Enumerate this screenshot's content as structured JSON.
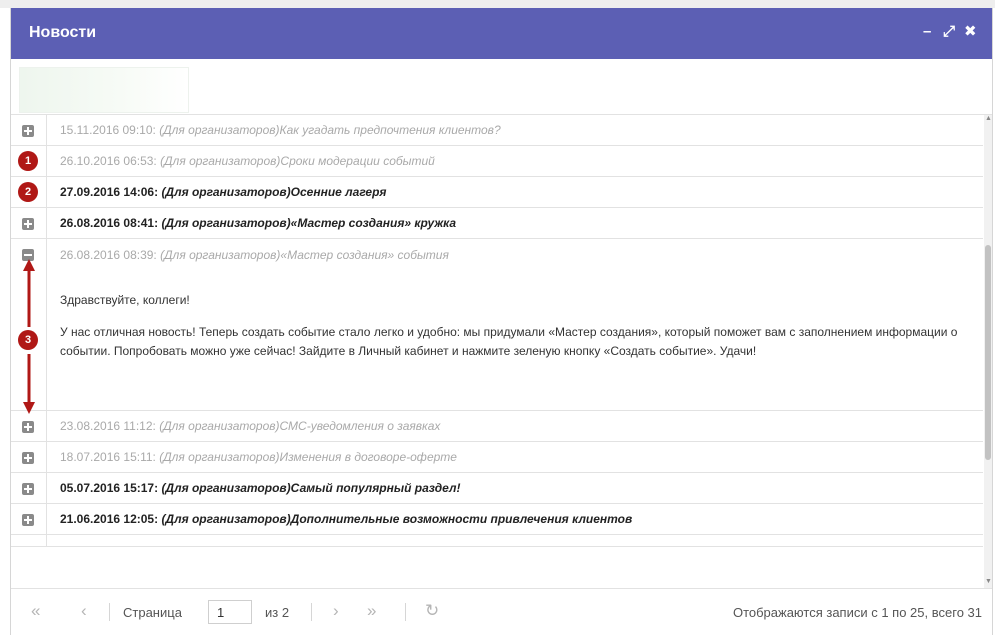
{
  "window": {
    "title": "Новости",
    "minimize_label": "–",
    "maximize_label": "⤢",
    "close_label": "✖"
  },
  "annotations": [
    "1",
    "2",
    "3"
  ],
  "rows_top": [
    {
      "date": "15.11.2016 09:10:",
      "subject": "(Для организаторов)Как угадать предпочтения клиентов?",
      "read": true,
      "marker": "toggle-plus"
    },
    {
      "date": "26.10.2016 06:53:",
      "subject": "(Для организаторов)Сроки модерации событий",
      "read": true,
      "marker": "badge-1"
    },
    {
      "date": "27.09.2016 14:06:",
      "subject": "(Для организаторов)Осенние лагеря",
      "read": false,
      "marker": "badge-2"
    },
    {
      "date": "26.08.2016 08:41:",
      "subject": "(Для организаторов)«Мастер создания» кружка",
      "read": false,
      "marker": "toggle-plus"
    }
  ],
  "expanded": {
    "date": "26.08.2016 08:39:",
    "subject": "(Для организаторов)«Мастер создания» события",
    "greeting": "Здравствуйте, коллеги!",
    "body": "У нас отличная новость! Теперь создать событие стало легко и удобно: мы придумали «Мастер создания», который поможет вам с заполнением информации о событии. Попробовать можно уже сейчас! Зайдите в Личный кабинет и нажмите зеленую кнопку «Создать событие». Удачи!"
  },
  "rows_bottom": [
    {
      "date": "23.08.2016 11:12:",
      "subject": "(Для организаторов)СМС-уведомления о заявках",
      "read": true
    },
    {
      "date": "18.07.2016 15:11:",
      "subject": "(Для организаторов)Изменения в договоре-оферте",
      "read": true
    },
    {
      "date": "05.07.2016 15:17:",
      "subject": "(Для организаторов)Самый популярный раздел!",
      "read": false
    },
    {
      "date": "21.06.2016 12:05:",
      "subject": "(Для организаторов)Дополнительные возможности привлечения клиентов",
      "read": false
    }
  ],
  "pager": {
    "first": "«",
    "prev": "‹",
    "page_label": "Страница",
    "page_value": "1",
    "of_label": "из 2",
    "next": "›",
    "last": "»",
    "refresh": "↻",
    "info": "Отображаются записи с 1 по 25, всего 31"
  },
  "colors": {
    "titlebar": "#5c5fb4",
    "badge": "#b01816",
    "arrow": "#b01816"
  }
}
